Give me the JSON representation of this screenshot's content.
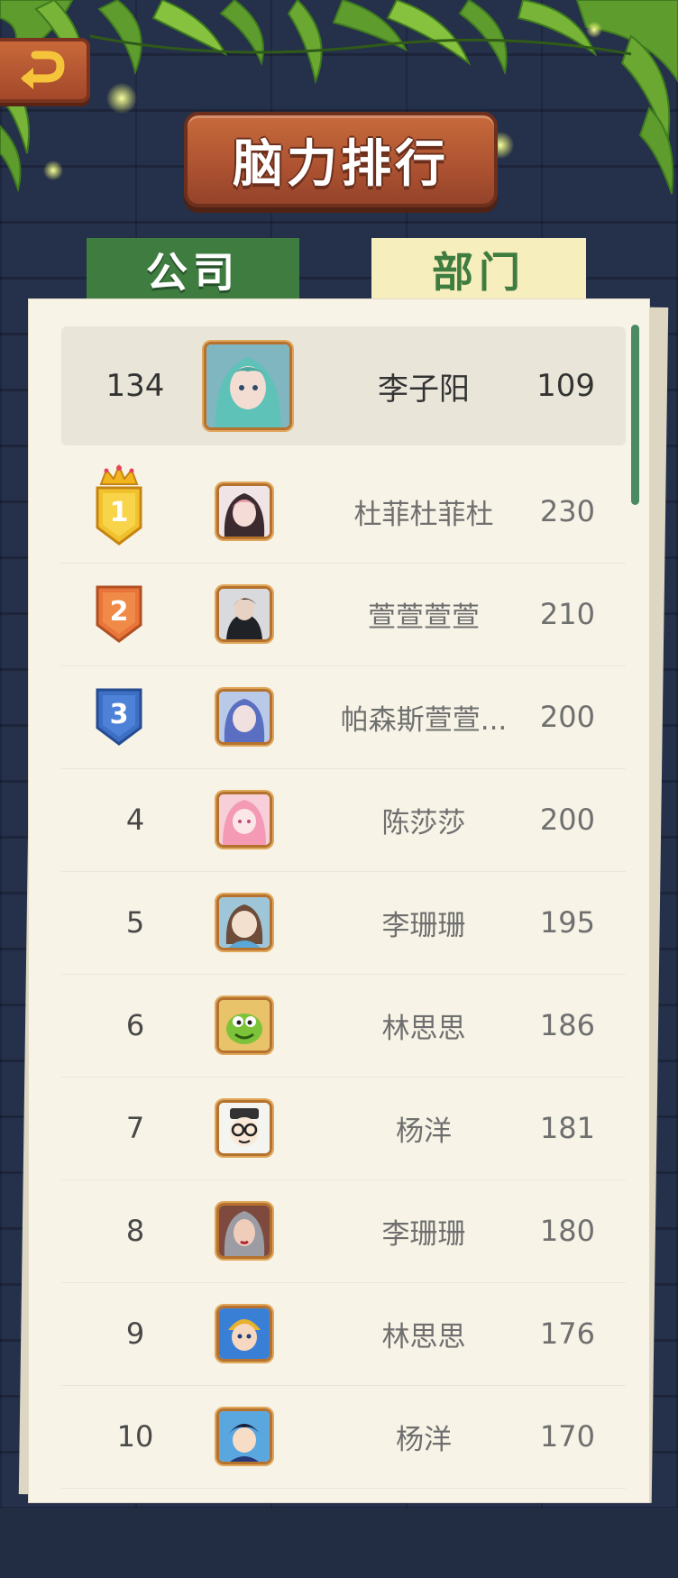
{
  "title": "脑力排行",
  "tabs": {
    "company": "公司",
    "department": "部门",
    "active": "company"
  },
  "my_entry": {
    "rank": "134",
    "name": "李子阳",
    "score": "109",
    "avatar": "avatar-teal-hair-girl"
  },
  "rankings": [
    {
      "rank": "1",
      "name": "杜菲杜菲杜",
      "score": "230",
      "avatar": "avatar-pink-hair-girl",
      "medal": "gold-crown-medal"
    },
    {
      "rank": "2",
      "name": "萱萱萱萱",
      "score": "210",
      "avatar": "avatar-dark-hair-boy",
      "medal": "orange-medal"
    },
    {
      "rank": "3",
      "name": "帕森斯萱萱...",
      "score": "200",
      "avatar": "avatar-blue-hair-girl",
      "medal": "blue-medal"
    },
    {
      "rank": "4",
      "name": "陈莎莎",
      "score": "200",
      "avatar": "avatar-pink-anime-girl"
    },
    {
      "rank": "5",
      "name": "李珊珊",
      "score": "195",
      "avatar": "avatar-brown-hair-girl"
    },
    {
      "rank": "6",
      "name": "林思思",
      "score": "186",
      "avatar": "avatar-green-monster"
    },
    {
      "rank": "7",
      "name": "杨洋",
      "score": "181",
      "avatar": "avatar-glasses-cartoon"
    },
    {
      "rank": "8",
      "name": "李珊珊",
      "score": "180",
      "avatar": "avatar-grey-hair-warrior"
    },
    {
      "rank": "9",
      "name": "林思思",
      "score": "176",
      "avatar": "avatar-blue-hero"
    },
    {
      "rank": "10",
      "name": "杨洋",
      "score": "170",
      "avatar": "avatar-detective-boy"
    }
  ],
  "colors": {
    "background": "#25304a",
    "wood": "#b0532f",
    "tab_active": "#3f7c3f",
    "tab_inactive": "#f7eebd",
    "paper": "#f7f3e6",
    "gold": "#f2c22e",
    "orange": "#e9753a",
    "blue": "#3d6fc4"
  }
}
